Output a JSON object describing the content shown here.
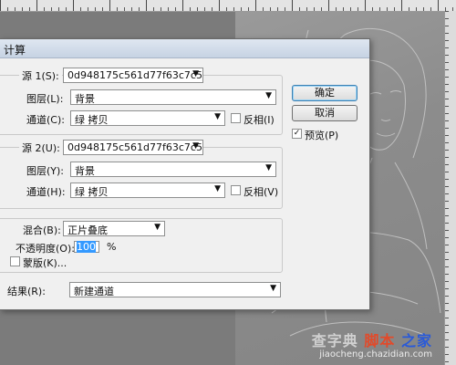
{
  "dialog": {
    "title": "计算",
    "source1": {
      "label": "源 1(S):",
      "file": "0d948175c561d77f63c7c5cd...",
      "layer_label": "图层(L):",
      "layer_value": "背景",
      "channel_label": "通道(C):",
      "channel_value": "绿 拷贝",
      "invert_label": "反相(I)"
    },
    "source2": {
      "label": "源 2(U):",
      "file": "0d948175c561d77f63c7c5cd...",
      "layer_label": "图层(Y):",
      "layer_value": "背景",
      "channel_label": "通道(H):",
      "channel_value": "绿 拷贝",
      "invert_label": "反相(V)"
    },
    "blending": {
      "label": "混合(B):",
      "value": "正片叠底",
      "opacity_label": "不透明度(O):",
      "opacity_value": "100",
      "opacity_unit": "%",
      "mask_label": "蒙版(K)..."
    },
    "result": {
      "label": "结果(R):",
      "value": "新建通道"
    },
    "buttons": {
      "ok": "确定",
      "cancel": "取消"
    },
    "preview": {
      "label": "预览(P)",
      "checked": true
    }
  },
  "watermark": {
    "brand_left": "查字典",
    "brand_mid": "脚本",
    "brand_right": "之家",
    "url": "jiaocheng.chazidian.com"
  },
  "colors": {
    "workspace": "#7b7b7b",
    "dialog_bg": "#f0f0f0",
    "selection": "#3399ff"
  }
}
